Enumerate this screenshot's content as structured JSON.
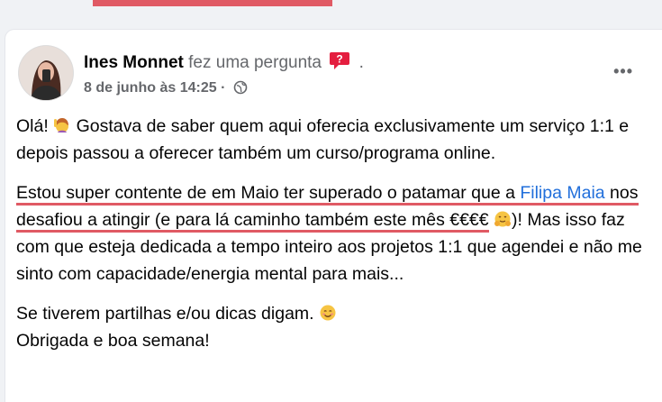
{
  "post": {
    "author": "Ines Monnet",
    "action": "fez uma pergunta",
    "separator": ".",
    "timestamp": "8 de junho às 14:25",
    "more": "•••"
  },
  "text": {
    "p1_a": "Olá! ",
    "p1_b": " Gostava de saber quem aqui oferecia exclusivamente um serviço 1:1 e depois passou a oferecer também um curso/programa online.",
    "p2_hl1": "Estou super contente de em Maio ter superado o patamar que a ",
    "p2_link": "Filipa Maia",
    "p2_hl2": " nos desafiou a atingir (e para lá caminho também este mês €€€€",
    "p2_rest": ")! Mas isso faz com que esteja dedicada a tempo inteiro aos projetos 1:1 que agendei e não me sinto com capacidade/energia mental para mais...",
    "p3_a": "Se tiverem partilhas e/ou dicas digam. ",
    "p3_b": "Obrigada e boa semana!"
  },
  "colors": {
    "highlight": "#e05a64",
    "link": "#216fdb",
    "secondary_text": "#65676b"
  },
  "icons": [
    "question-icon",
    "globe-icon",
    "woman-raising-hand-emoji",
    "hugging-face-emoji",
    "smiling-face-emoji"
  ]
}
